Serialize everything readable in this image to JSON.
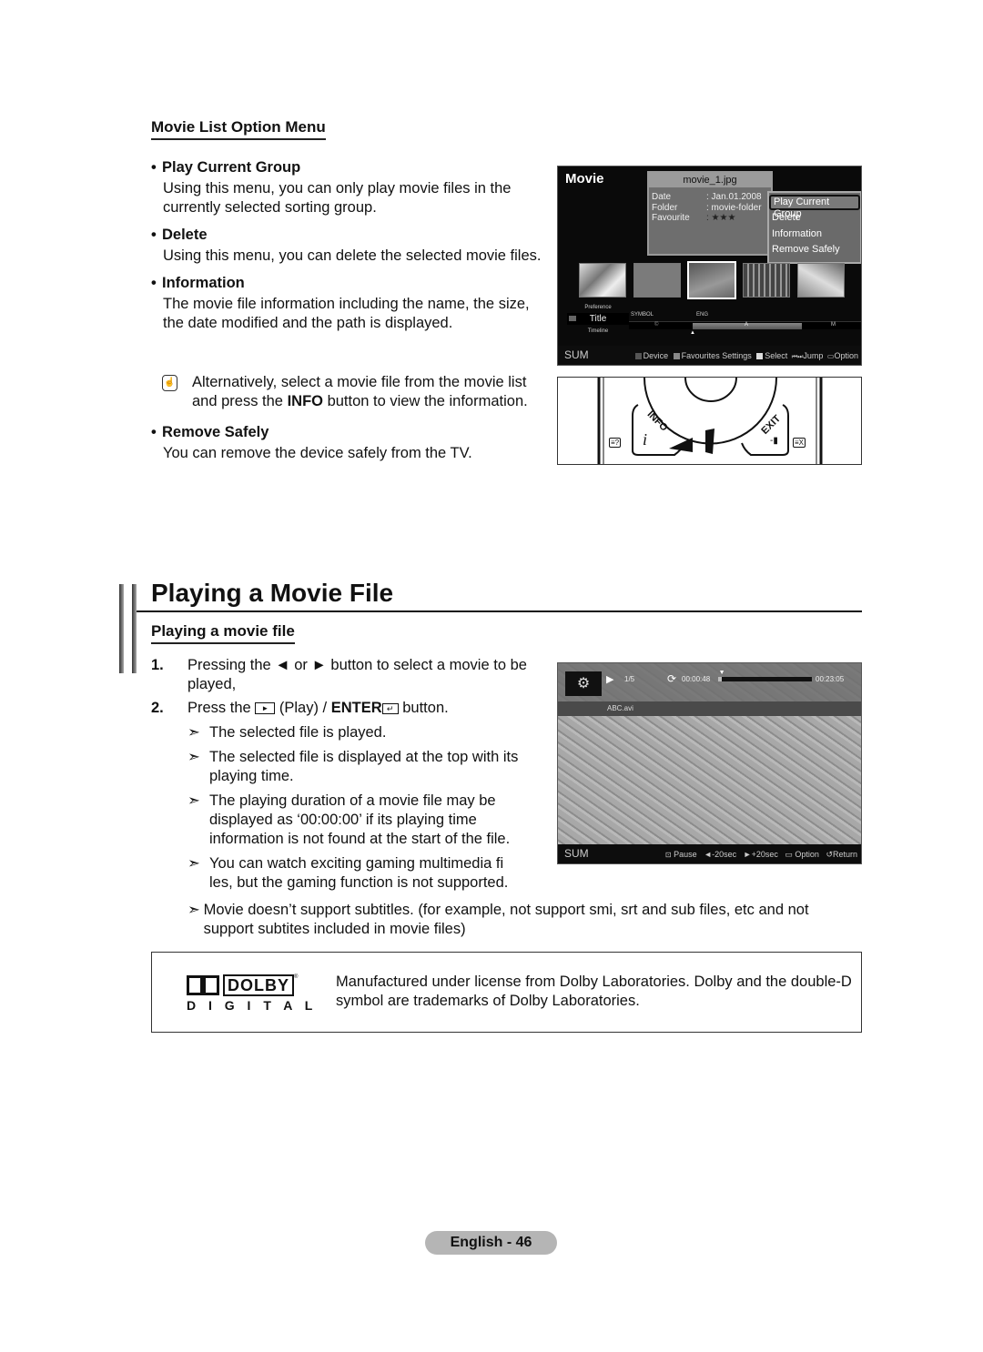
{
  "option_menu": {
    "heading": "Movie List Option Menu",
    "items": [
      {
        "title": "Play Current Group",
        "text": "Using this menu, you can only play movie files in the currently selected sorting group."
      },
      {
        "title": "Delete",
        "text": "Using this menu, you can delete the selected movie files."
      },
      {
        "title": "Information",
        "text": "The movie file information including the name, the size, the date modified and the path is displayed."
      },
      {
        "title": "Remove Safely",
        "text": "You can remove the device safely from the TV."
      }
    ],
    "note_pre": "Alternatively, select a movie file from the movie list and press the ",
    "note_bold": "INFO",
    "note_post": " button to view the information."
  },
  "movie_screen": {
    "title": "Movie",
    "file_name": "movie_1.jpg",
    "info": [
      {
        "key": "Date",
        "value": ": Jan.01.2008"
      },
      {
        "key": "Folder",
        "value": ": movie-folder"
      },
      {
        "key": "Favourite",
        "value": ": ★★★"
      }
    ],
    "menu": [
      "Play Current Group",
      "Delete",
      "Information",
      "Remove Safely"
    ],
    "menu_selected": 0,
    "sort": {
      "prev": "Preference",
      "current": "Title",
      "next": "Timeline"
    },
    "index_labels": {
      "symbol": "SYMBOL",
      "eng": "ENG",
      "c": "©",
      "a": "A",
      "m": "M"
    },
    "footer": {
      "source": "SUM",
      "device": "Device",
      "favourites": "Favourites Settings",
      "select": "Select",
      "jump": "Jump",
      "option": "Option"
    },
    "colors": {
      "red_btn": "#555555",
      "green_btn": "#888888",
      "yellow_btn": "#dddddd"
    }
  },
  "remote": {
    "info_label": "INFO",
    "exit_label": "EXIT"
  },
  "section": {
    "title": "Playing a Movie File",
    "subheading": "Playing a movie file",
    "steps": [
      {
        "num": "1.",
        "pre": "Pressing the ◄ or ► button to select a movie to be played,"
      },
      {
        "num": "2.",
        "pre": "Press the ",
        "mid": " (Play) / ",
        "bold": "ENTER",
        "post": " button."
      }
    ],
    "notes": [
      "The selected file is played.",
      "The selected file is displayed at the top with its playing time.",
      "The playing duration of a movie file may be displayed as ‘00:00:00’ if its playing time information is not found at the start of the file.",
      "You can watch exciting gaming multimedia fi les, but the gaming function is not supported.",
      "Movie doesn’t support subtitles. (for example, not support smi, srt and sub files, etc and not support subtites included in movie files)"
    ]
  },
  "player": {
    "counter": "1/5",
    "elapsed": "00:00:48",
    "total": "00:23:05",
    "progress_fraction": 0.035,
    "file_name": "ABC.avi",
    "footer": {
      "source": "SUM",
      "pause": "Pause",
      "rew": "-20sec",
      "ff": "+20sec",
      "option": "Option",
      "return": "Return"
    }
  },
  "dolby": {
    "logo_word": "DOLBY",
    "logo_sub": "D I G I T A L",
    "text": "Manufactured under license from Dolby Laboratories. Dolby and the double-D symbol are trademarks of Dolby Laboratories."
  },
  "page_footer": "English - 46"
}
